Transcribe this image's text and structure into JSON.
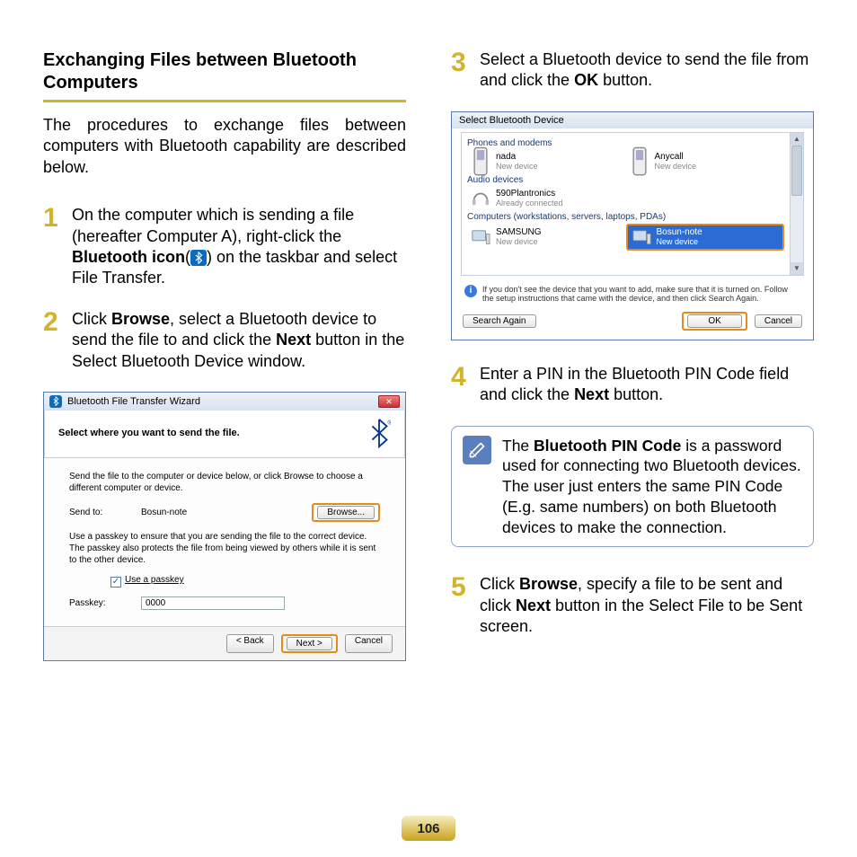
{
  "title": "Exchanging Files between Bluetooth Computers",
  "intro": "The procedures to exchange files between computers with Bluetooth capability are described below.",
  "step1": {
    "pre": "On the computer which is sending a file (hereafter Computer A), right-click the ",
    "bold1": "Bluetooth icon",
    "post": " on the taskbar and select File Transfer."
  },
  "step2": {
    "pre": "Click ",
    "bold1": "Browse",
    "mid1": ", select a Bluetooth device to send the file to and click the ",
    "bold2": "Next",
    "post": " button in the Select Bluetooth Device window."
  },
  "step3": {
    "pre": "Select a Bluetooth device to send the file from and click the ",
    "bold1": "OK",
    "post": " button."
  },
  "step4": {
    "pre": "Enter a PIN in the Bluetooth PIN Code field and click the ",
    "bold1": "Next",
    "post": " button."
  },
  "note": {
    "pre": "The ",
    "bold1": "Bluetooth PIN Code",
    "post": " is a password used for connecting two Bluetooth devices. The user just enters the same PIN Code (E.g. same numbers) on both Bluetooth devices to make the connection."
  },
  "step5": {
    "pre": "Click ",
    "bold1": "Browse",
    "mid1": ", specify a file to be sent and click ",
    "bold2": "Next",
    "post": " button in the Select File to be Sent screen."
  },
  "dialog1": {
    "title": "Bluetooth File Transfer Wizard",
    "header": "Select where you want to send the file.",
    "text1": "Send the file to the computer or device below, or click Browse to choose a different computer or device.",
    "sendto_label": "Send to:",
    "sendto_value": "Bosun-note",
    "browse": "Browse...",
    "text2": "Use a passkey to ensure that you are sending the file to the correct device. The passkey also protects the file from being viewed by others while it is sent to the other device.",
    "use_passkey": "Use a passkey",
    "passkey_label": "Passkey:",
    "passkey_value": "0000",
    "back": "< Back",
    "next": "Next >",
    "cancel": "Cancel"
  },
  "dialog2": {
    "title": "Select Bluetooth Device",
    "cat1": "Phones and modems",
    "dev_nada_name": "nada",
    "dev_nada_sub": "New device",
    "dev_anycall_name": "Anycall",
    "dev_anycall_sub": "New device",
    "cat2": "Audio devices",
    "dev_590_name": "590Plantronics",
    "dev_590_sub": "Already connected",
    "cat3": "Computers (workstations, servers, laptops, PDAs)",
    "dev_samsung_name": "SAMSUNG",
    "dev_samsung_sub": "New device",
    "dev_bosun_name": "Bosun-note",
    "dev_bosun_sub": "New device",
    "info": "If you don't see the device that you want to add, make sure that it is turned on. Follow the setup instructions that came with the device, and then click Search Again.",
    "search": "Search Again",
    "ok": "OK",
    "cancel": "Cancel"
  },
  "page_number": "106"
}
